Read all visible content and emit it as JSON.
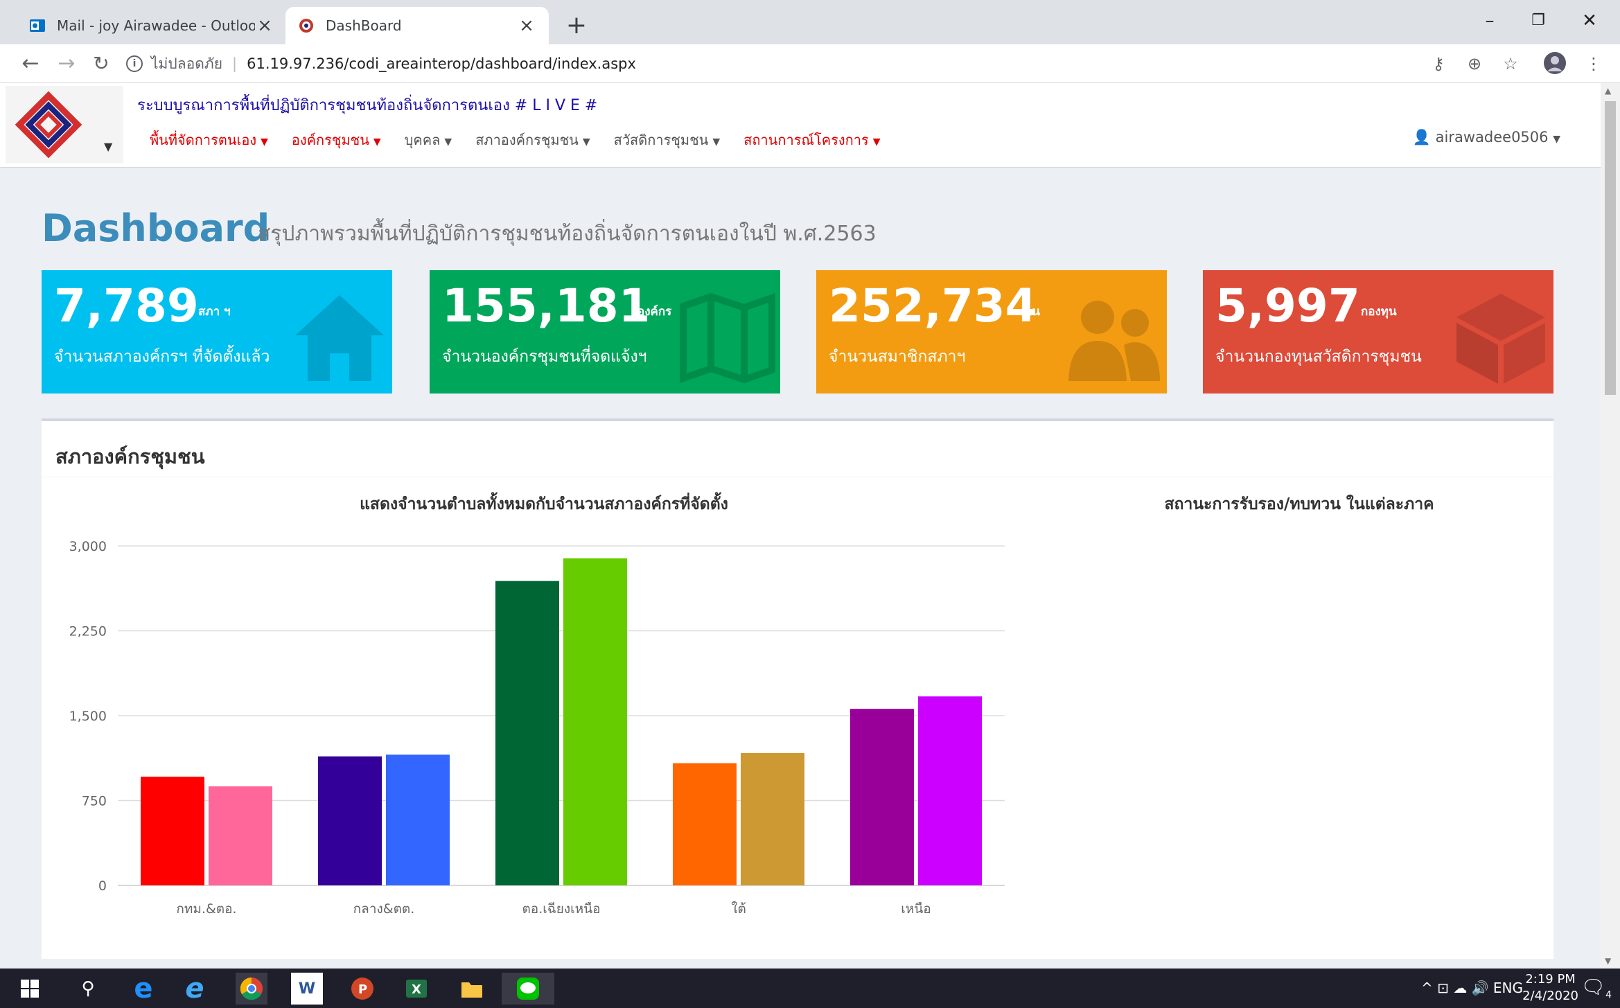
{
  "browser": {
    "tabs": [
      {
        "label": "Mail - joy Airawadee - Outlook",
        "active": false
      },
      {
        "label": "DashBoard",
        "active": true
      }
    ],
    "security_label": "ไม่ปลอดภัย",
    "url": "61.19.97.236/codi_areainterop/dashboard/index.aspx"
  },
  "header": {
    "system_title": "ระบบบูรณาการพื้นที่ปฏิบัติการชุมชนท้องถิ่นจัดการตนเอง # L I V E #",
    "menu": [
      {
        "label": "พื้นที่จัดการตนเอง",
        "red": true
      },
      {
        "label": "องค์กรชุมชน",
        "red": true
      },
      {
        "label": "บุคคล",
        "red": false
      },
      {
        "label": "สภาองค์กรชุมชน",
        "red": false
      },
      {
        "label": "สวัสดิการชุมชน",
        "red": false
      },
      {
        "label": "สถานการณ์โครงการ",
        "red": true
      }
    ],
    "user": "airawadee0506"
  },
  "page": {
    "title": "Dashboard",
    "subtitle": "สรุปภาพรวมพื้นที่ปฏิบัติการชุมชนท้องถิ่นจัดการตนเองในปี พ.ศ.2563"
  },
  "stats": [
    {
      "value": "7,789",
      "unit": "สภา ฯ",
      "label": "จำนวนสภาองค์กรฯ ที่จัดตั้งแล้ว",
      "color": "#00c0ef",
      "icon": "home-icon"
    },
    {
      "value": "155,181",
      "unit": "องค์กร",
      "label": "จำนวนองค์กรชุมชนที่จดแจ้งฯ",
      "color": "#00a65a",
      "icon": "map-icon"
    },
    {
      "value": "252,734",
      "unit": "คน",
      "label": "จำนวนสมาชิกสภาฯ",
      "color": "#f39c12",
      "icon": "users-icon"
    },
    {
      "value": "5,997",
      "unit": "กองทุน",
      "label": "จำนวนกองทุนสวัสดิการชุมชน",
      "color": "#dd4b39",
      "icon": "cube-icon"
    }
  ],
  "panel": {
    "title": "สภาองค์กรชุมชน",
    "right_chart_title": "สถานะการรับรอง/ทบทวน ในแต่ละภาค"
  },
  "chart_data": {
    "type": "bar",
    "title": "แสดงจำนวนตำบลทั้งหมดกับจำนวนสภาองค์กรที่จัดตั้ง",
    "categories": [
      "กทม.&ตอ.",
      "กลาง&ตต.",
      "ตอ.เฉียงเหนือ",
      "ใต้",
      "เหนือ"
    ],
    "series": [
      {
        "values": [
          960,
          1140,
          2690,
          1080,
          1560
        ]
      },
      {
        "values": [
          875,
          1155,
          2890,
          1170,
          1670
        ]
      }
    ],
    "bar_colors": [
      [
        "#ff0000",
        "#ff6699"
      ],
      [
        "#330099",
        "#3366ff"
      ],
      [
        "#006633",
        "#66cc00"
      ],
      [
        "#ff6600",
        "#cc9933"
      ],
      [
        "#990099",
        "#cc00ff"
      ]
    ],
    "yticks": [
      "0",
      "750",
      "1,500",
      "2,250",
      "3,000"
    ],
    "ylim": [
      0,
      3000
    ],
    "grid": true
  },
  "taskbar": {
    "language": "ENG",
    "time": "2:19 PM",
    "date": "2/4/2020",
    "notifications": "4"
  }
}
